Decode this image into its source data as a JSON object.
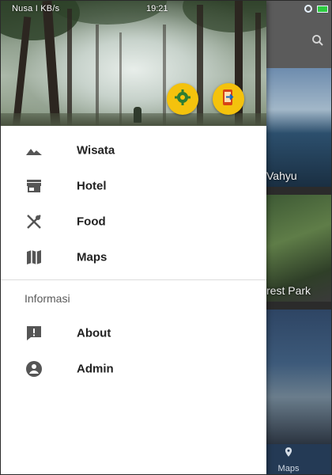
{
  "status_bar": {
    "left_text": "Nusa I KB/s",
    "time": "19:21"
  },
  "background_app": {
    "cards": [
      {
        "title": "Vahyu"
      },
      {
        "title": "rest Park"
      },
      {
        "title": ""
      }
    ],
    "bottom_nav": {
      "maps_label": "Maps"
    }
  },
  "drawer": {
    "header": {
      "buttons": [
        {
          "icon": "settings-icon",
          "color": "#f4c20d"
        },
        {
          "icon": "logout-icon",
          "color": "#f4c20d"
        }
      ]
    },
    "main_items": [
      {
        "label": "Wisata",
        "icon": "landscape-icon"
      },
      {
        "label": "Hotel",
        "icon": "store-icon"
      },
      {
        "label": "Food",
        "icon": "restaurant-icon"
      },
      {
        "label": "Maps",
        "icon": "map-icon"
      }
    ],
    "info_section": {
      "heading": "Informasi",
      "items": [
        {
          "label": "About",
          "icon": "feedback-icon"
        },
        {
          "label": "Admin",
          "icon": "admin-icon"
        }
      ]
    }
  },
  "colors": {
    "accent_yellow": "#f4c20d",
    "menu_icon": "#555555",
    "label_text": "#222222"
  }
}
